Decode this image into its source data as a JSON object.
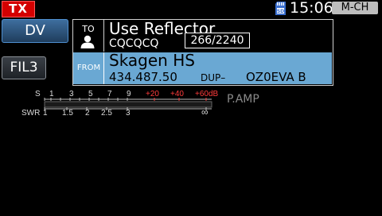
{
  "status_bar": {
    "tx_label": "TX",
    "time": "15:06",
    "mode_badge": "M-CH",
    "sd_icon": "sd-card-icon"
  },
  "left_buttons": {
    "dv_label": "DV",
    "filter_label": "FIL3"
  },
  "to_section": {
    "label": "TO",
    "title": "Use Reflector",
    "callsign": "CQCQCQ",
    "counter": "266/2240",
    "icon": "user-icon"
  },
  "from_section": {
    "label": "FROM",
    "name": "Skagen HS",
    "frequency": "434.487.50",
    "duplex": "DUP–",
    "callsign": "OZ0EVA B"
  },
  "meter": {
    "s_label": "S",
    "s_scale": [
      "1",
      "3",
      "5",
      "7",
      "9"
    ],
    "s_over_scale": [
      "+20",
      "+40",
      "+60dB"
    ],
    "swr_label": "SWR",
    "swr_scale": [
      "1",
      "1.5",
      "2",
      "2.5",
      "3",
      "∞"
    ],
    "pamp_label": "P.AMP",
    "colors": {
      "normal": "#dddddd",
      "over": "#ff3c3c"
    }
  },
  "colors": {
    "tx": "#d40000",
    "from_row": "#6aa8d3",
    "dv_button": "#2f5a85"
  }
}
